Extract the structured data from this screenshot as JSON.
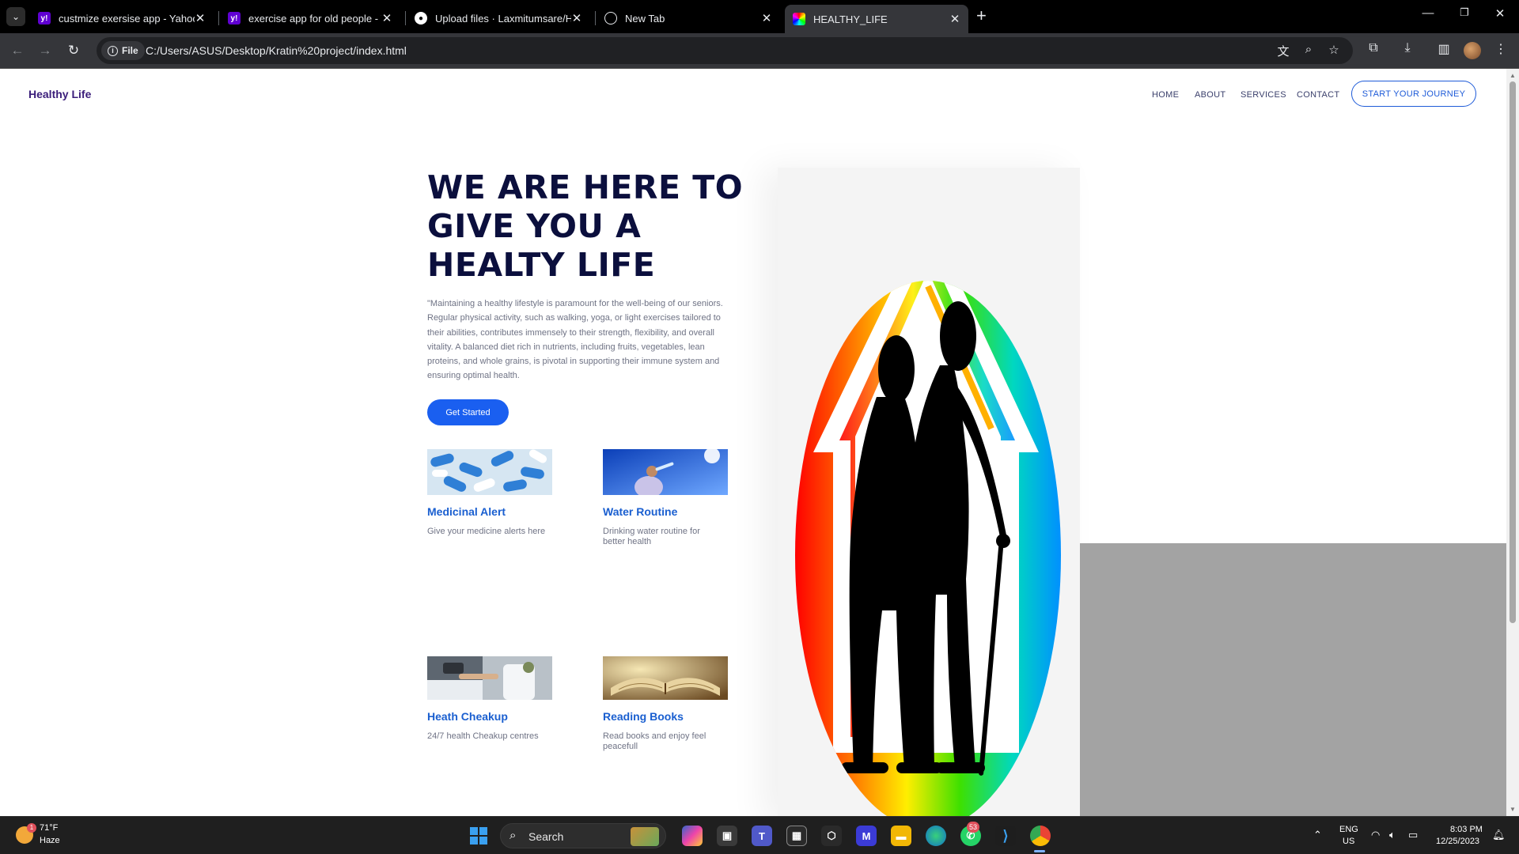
{
  "browser": {
    "tabs": [
      {
        "title": "custmize exersise app - Yahoo S",
        "favicon": "yahoo-icon",
        "active": false
      },
      {
        "title": "exercise app for old people - Ya",
        "favicon": "yahoo-icon",
        "active": false
      },
      {
        "title": "Upload files · Laxmitumsare/He",
        "favicon": "github-icon",
        "active": false
      },
      {
        "title": "New Tab",
        "favicon": "globe-icon",
        "active": false
      },
      {
        "title": "HEALTHY_LIFE",
        "favicon": "site-icon",
        "active": true
      }
    ],
    "address": {
      "chip": "File",
      "url": "C:/Users/ASUS/Desktop/Kratin%20project/index.html"
    }
  },
  "site": {
    "brand": "Healthy Life",
    "nav": [
      "HOME",
      "ABOUT",
      "SERVICES",
      "CONTACT"
    ],
    "cta": "START YOUR JOURNEY",
    "hero": {
      "title": "WE ARE HERE TO GIVE YOU A HEALTY LIFE",
      "text": "\"Maintaining a healthy lifestyle is paramount for the well-being of our seniors. Regular physical activity, such as walking, yoga, or light exercises tailored to their abilities, contributes immensely to their strength, flexibility, and overall vitality. A balanced diet rich in nutrients, including fruits, vegetables, lean proteins, and whole grains, is pivotal in supporting their immune system and ensuring optimal health.",
      "button": "Get Started"
    },
    "cards": [
      {
        "title": "Medicinal Alert",
        "desc": "Give your medicine alerts here"
      },
      {
        "title": "Water Routine",
        "desc": "Drinking water routine for better health"
      },
      {
        "title": "Heath Cheakup",
        "desc": "24/7 health Cheakup centres"
      },
      {
        "title": "Reading Books",
        "desc": "Read books and enjoy feel peacefull"
      }
    ],
    "colors": {
      "accent": "#1a5ff0",
      "title": "#0b0f3d",
      "brand": "#3a1d7a"
    }
  },
  "taskbar": {
    "weather": {
      "temp": "71°F",
      "condition": "Haze",
      "badge": "1"
    },
    "search": "Search",
    "whatsapp_badge": "53",
    "lang": [
      "ENG",
      "US"
    ],
    "time": "8:03 PM",
    "date": "12/25/2023"
  }
}
